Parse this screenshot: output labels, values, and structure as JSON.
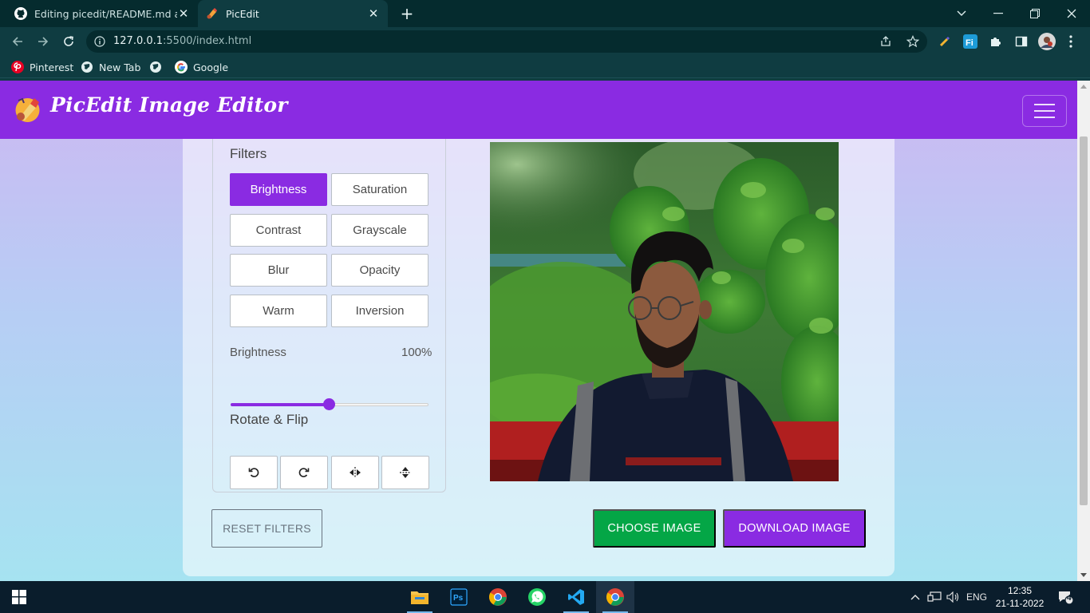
{
  "browser": {
    "tabs": [
      {
        "title": "Editing picedit/README.md at m",
        "icon": "github-icon",
        "active": false
      },
      {
        "title": "PicEdit",
        "icon": "picedit-favicon",
        "active": true
      }
    ],
    "new_tab": "+",
    "url_host": "127.0.0.1",
    "url_path": ":5500/index.html",
    "bookmarks": [
      {
        "label": "Pinterest",
        "icon": "pinterest-icon"
      },
      {
        "label": "New Tab",
        "icon": "globe-icon"
      },
      {
        "label": "",
        "icon": "globe-icon"
      },
      {
        "label": "Google",
        "icon": "google-icon"
      }
    ]
  },
  "app": {
    "brand": "PicEdit Image Editor",
    "filters_title": "Filters",
    "filters": [
      {
        "label": "Brightness",
        "active": true
      },
      {
        "label": "Saturation",
        "active": false
      },
      {
        "label": "Contrast",
        "active": false
      },
      {
        "label": "Grayscale",
        "active": false
      },
      {
        "label": "Blur",
        "active": false
      },
      {
        "label": "Opacity",
        "active": false
      },
      {
        "label": "Warm",
        "active": false
      },
      {
        "label": "Inversion",
        "active": false
      }
    ],
    "slider_name": "Brightness",
    "slider_value_text": "100%",
    "slider_fraction": 0.5,
    "rotate_title": "Rotate & Flip",
    "rotate_buttons": [
      "rotate-left-icon",
      "rotate-right-icon",
      "flip-horizontal-icon",
      "flip-vertical-icon"
    ],
    "reset_label": "RESET FILTERS",
    "choose_label": "CHOOSE IMAGE",
    "download_label": "DOWNLOAD IMAGE",
    "colors": {
      "accent": "#8a2be2",
      "success": "#04a646"
    }
  },
  "taskbar": {
    "apps": [
      "file-explorer-icon",
      "photoshop-icon",
      "chrome-icon",
      "whatsapp-icon",
      "vscode-icon",
      "chrome-icon"
    ],
    "lang": "ENG",
    "time": "12:35",
    "date": "21-11-2022",
    "notifications": "4"
  }
}
